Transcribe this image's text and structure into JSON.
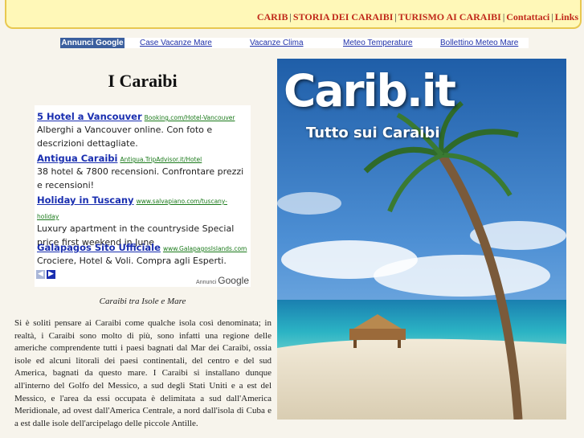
{
  "nav": {
    "items": [
      "CARIB",
      "STORIA DEI CARAIBI",
      "TURISMO AI CARAIBI",
      "Contattaci",
      "Links"
    ]
  },
  "linkbar": {
    "badge": "Annunci Google",
    "links": [
      "Case Vacanze Mare",
      "Vacanze Clima",
      "Meteo Temperature",
      "Bollettino Meteo Mare"
    ]
  },
  "page_title": "I Caraibi",
  "ads": [
    {
      "headline": "5 Hotel a Vancouver",
      "url": "Booking.com/Hotel-Vancouver",
      "text": "Alberghi a Vancouver online. Con foto e descrizioni dettagliate."
    },
    {
      "headline": "Antigua Caraibi",
      "url": "Antigua.TripAdvisor.it/Hotel",
      "text": "38 hotel & 7800 recensioni. Confrontare prezzi e recensioni!"
    },
    {
      "headline": "Holiday in Tuscany",
      "url": "www.salvapiano.com/tuscany-holiday",
      "text": "Luxury apartment in the countryside Special price first weekend in June"
    },
    {
      "headline": "Galapagos Sito Ufficiale",
      "url": "www.GalapagosIslands.com",
      "text": "Crociere, Hotel & Voli. Compra agli Esperti."
    }
  ],
  "ad_footer": {
    "prefix": "Annunci",
    "brand": "Google"
  },
  "caption": "Caraibi tra Isole e Mare",
  "body_text": "Si è soliti pensare ai Caraibi come qualche isola così denominata; in realtà, i Caraibi sono molto di più, sono infatti una regione delle americhe comprendente tutti i paesi bagnati dal Mar dei Caraibi, ossia isole ed alcuni litorali dei paesi continentali, del centro e del sud America, bagnati da questo mare. I Caraibi si installano dunque all'interno del Golfo del Messico, a sud degli Stati Uniti e a est del Messico, e l'area da essi occupata è delimitata a sud dall'America Meridionale, ad ovest dall'America Centrale, a nord dall'isola di Cuba e a est dalle isole dell'arcipelago delle piccole Antille.",
  "hero": {
    "brand": "Carib.it",
    "tagline": "Tutto sui Caraibi"
  },
  "colors": {
    "accent": "#c0291a",
    "ad_link": "#1a2fb0",
    "ad_url": "#1b7a1b",
    "badge": "#3b5f9e",
    "topbar": "#fff8b8"
  }
}
